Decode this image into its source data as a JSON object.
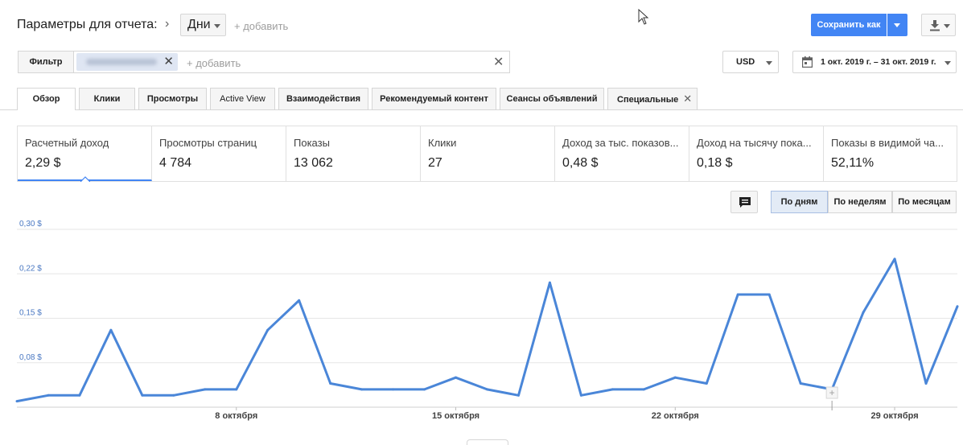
{
  "header": {
    "title": "Параметры для отчета:",
    "dimension": "Дни",
    "add_label": "+ добавить",
    "save_label": "Сохранить как",
    "download_icon": "download-icon"
  },
  "filter": {
    "button_label": "Фильтр",
    "add_placeholder": "+ добавить"
  },
  "currency": "USD",
  "date_range": "1 окт. 2019 г. – 31 окт. 2019 г.",
  "tabs": [
    {
      "label": "Обзор"
    },
    {
      "label": "Клики"
    },
    {
      "label": "Просмотры"
    },
    {
      "label": "Active View"
    },
    {
      "label": "Взаимодействия"
    },
    {
      "label": "Рекомендуемый контент"
    },
    {
      "label": "Сеансы объявлений"
    },
    {
      "label": "Специальные"
    }
  ],
  "metrics": [
    {
      "label": "Расчетный доход",
      "value": "2,29 $"
    },
    {
      "label": "Просмотры страниц",
      "value": "4 784"
    },
    {
      "label": "Показы",
      "value": "13 062"
    },
    {
      "label": "Клики",
      "value": "27"
    },
    {
      "label": "Доход за тыс. показов...",
      "value": "0,48 $"
    },
    {
      "label": "Доход на тысячу пока...",
      "value": "0,18 $"
    },
    {
      "label": "Показы в видимой ча...",
      "value": "52,11%"
    }
  ],
  "periods": [
    {
      "label": "По дням"
    },
    {
      "label": "По неделям"
    },
    {
      "label": "По месяцам"
    }
  ],
  "colors": {
    "accent": "#4285f4",
    "line": "#4a86d8"
  },
  "chart_data": {
    "type": "line",
    "title": "",
    "xlabel": "",
    "ylabel": "",
    "ylim": [
      0,
      0.3
    ],
    "y_ticks": [
      {
        "value": 0.075,
        "label": "0,08 $"
      },
      {
        "value": 0.15,
        "label": "0,15 $"
      },
      {
        "value": 0.225,
        "label": "0,22 $"
      },
      {
        "value": 0.3,
        "label": "0,30 $"
      }
    ],
    "x_ticks": [
      {
        "day": 8,
        "label": "8 октября"
      },
      {
        "day": 15,
        "label": "15 октября"
      },
      {
        "day": 22,
        "label": "22 октября"
      },
      {
        "day": 29,
        "label": "29 октября"
      }
    ],
    "x": [
      1,
      2,
      3,
      4,
      5,
      6,
      7,
      8,
      9,
      10,
      11,
      12,
      13,
      14,
      15,
      16,
      17,
      18,
      19,
      20,
      21,
      22,
      23,
      24,
      25,
      26,
      27,
      28,
      29,
      30,
      31
    ],
    "series": [
      {
        "values": [
          0.01,
          0.02,
          0.02,
          0.13,
          0.02,
          0.02,
          0.03,
          0.03,
          0.13,
          0.18,
          0.04,
          0.03,
          0.03,
          0.03,
          0.05,
          0.03,
          0.02,
          0.21,
          0.02,
          0.03,
          0.03,
          0.05,
          0.04,
          0.19,
          0.19,
          0.04,
          0.03,
          0.16,
          0.25,
          0.04,
          0.17
        ]
      }
    ]
  }
}
